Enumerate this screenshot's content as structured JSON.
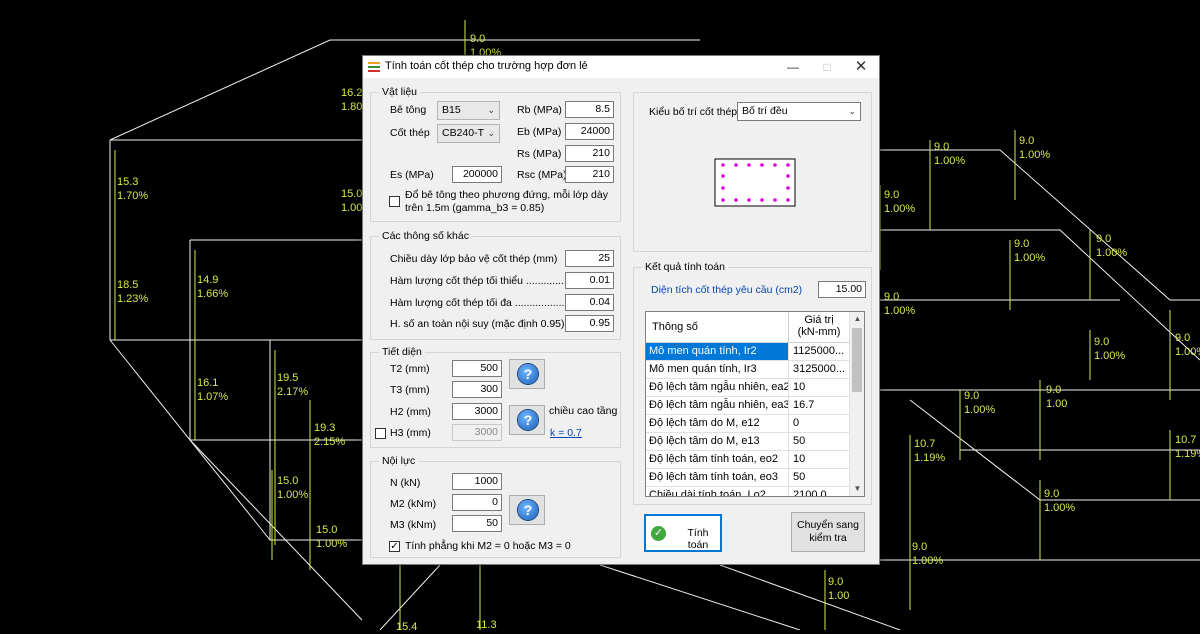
{
  "window": {
    "title": "Tính toán cốt thép cho trường hợp đơn lẻ"
  },
  "material": {
    "group_title": "Vật liệu",
    "concrete_label": "Bê tông",
    "concrete_value": "B15",
    "steel_label": "Cốt thép",
    "steel_value": "CB240-T",
    "rb_label": "Rb (MPa)",
    "rb_value": "8.5",
    "eb_label": "Eb (MPa)",
    "eb_value": "24000",
    "rs_label": "Rs (MPa)",
    "rs_value": "210",
    "es_label": "Es (MPa)",
    "es_value": "200000",
    "rsc_label": "Rsc (MPa)",
    "rsc_value": "210",
    "vertical_check_line1": "Đổ bê tông theo phương đứng, mỗi lớp dày",
    "vertical_check_line2": "trên 1.5m (gamma_b3 = 0.85)"
  },
  "other": {
    "group_title": "Các thông số khác",
    "cover_label": "Chiều dày lớp bảo vệ cốt thép (mm)",
    "cover_value": "25",
    "min_label": "Hàm lượng cốt thép tối thiểu ................",
    "min_value": "0.01",
    "max_label": "Hàm lượng cốt thép tối đa ........................",
    "max_value": "0.04",
    "safety_label": "H. số an toàn nội suy (mặc định 0.95)",
    "safety_value": "0.95"
  },
  "section": {
    "group_title": "Tiết diện",
    "t2_label": "T2 (mm)",
    "t2_value": "500",
    "t3_label": "T3 (mm)",
    "t3_value": "300",
    "h2_label": "H2 (mm)",
    "h2_value": "3000",
    "h3_label": "H3 (mm)",
    "h3_value": "3000",
    "story_label": "chiều cao tầng",
    "k_link": "k = 0.7"
  },
  "forces": {
    "group_title": "Nội lực",
    "n_label": "N (kN)",
    "n_value": "1000",
    "m2_label": "M2 (kNm)",
    "m2_value": "0",
    "m3_label": "M3 (kNm)",
    "m3_value": "50",
    "flat_check": "Tính phẳng khi M2 = 0 hoặc M3 = 0"
  },
  "layout_panel": {
    "label": "Kiểu bố trí cốt thép",
    "value": "Bố trí đều"
  },
  "results": {
    "group_title": "Kết quả tính toán",
    "area_label": "Diện tích cốt thép yêu cầu (cm2)",
    "area_value": "15.00",
    "col1": "Thông số",
    "col2_line1": "Giá trị",
    "col2_line2": "(kN-mm)",
    "rows": [
      {
        "name": "Mô men quán tính, Ir2",
        "value": "1125000..."
      },
      {
        "name": "Mô men quán tính, Ir3",
        "value": "3125000..."
      },
      {
        "name": "Độ lệch tâm ngẫu nhiên, ea2",
        "value": "10"
      },
      {
        "name": "Độ lệch tâm ngẫu nhiên, ea3",
        "value": "16.7"
      },
      {
        "name": "Độ lệch tâm do M, e12",
        "value": "0"
      },
      {
        "name": "Độ lệch tâm do M, e13",
        "value": "50"
      },
      {
        "name": "Độ lệch tâm tính toán, eo2",
        "value": "10"
      },
      {
        "name": "Độ lệch tâm tính toán, eo3",
        "value": "50"
      },
      {
        "name": "Chiều dài tính toán, Lo2",
        "value": "2100.0"
      }
    ]
  },
  "buttons": {
    "calculate": "Tính toán",
    "switch_line1": "Chuyển sang",
    "switch_line2": "kiểm tra"
  },
  "background_labels": [
    "9.0\n1.00%",
    "16.2\n1.80",
    "15.3\n1.70%",
    "15.0\n1.00",
    "14.9\n1.66%",
    "18.5\n1.23%",
    "16.1\n1.07%",
    "19.5\n2.17%",
    "19.3\n2.15%",
    "15.0\n1.00%",
    "15.0\n1.00%",
    "15.4",
    "11.3",
    "9.0\n1.00%",
    "9.0\n1.00%",
    "9.0\n1.00%",
    "9.0\n1.00%",
    "9.0\n1.00%",
    "9.0\n1.00%",
    "9.0\n1.00%",
    "9.0\n1.00%",
    "9.0\n1.00%",
    "9.0\n1.00",
    "10.7\n1.19%",
    "10.7\n1.19%",
    "9.0\n1.00%",
    "9.0\n1.00%",
    "9.0\n1.00",
    "9.0\n1.00%",
    "9.0\n1.00%",
    "9.0\n1.00%"
  ],
  "colors": {
    "bg_label": "#d8e84a",
    "accent": "#0078d7",
    "rebar": "#e000e0"
  }
}
